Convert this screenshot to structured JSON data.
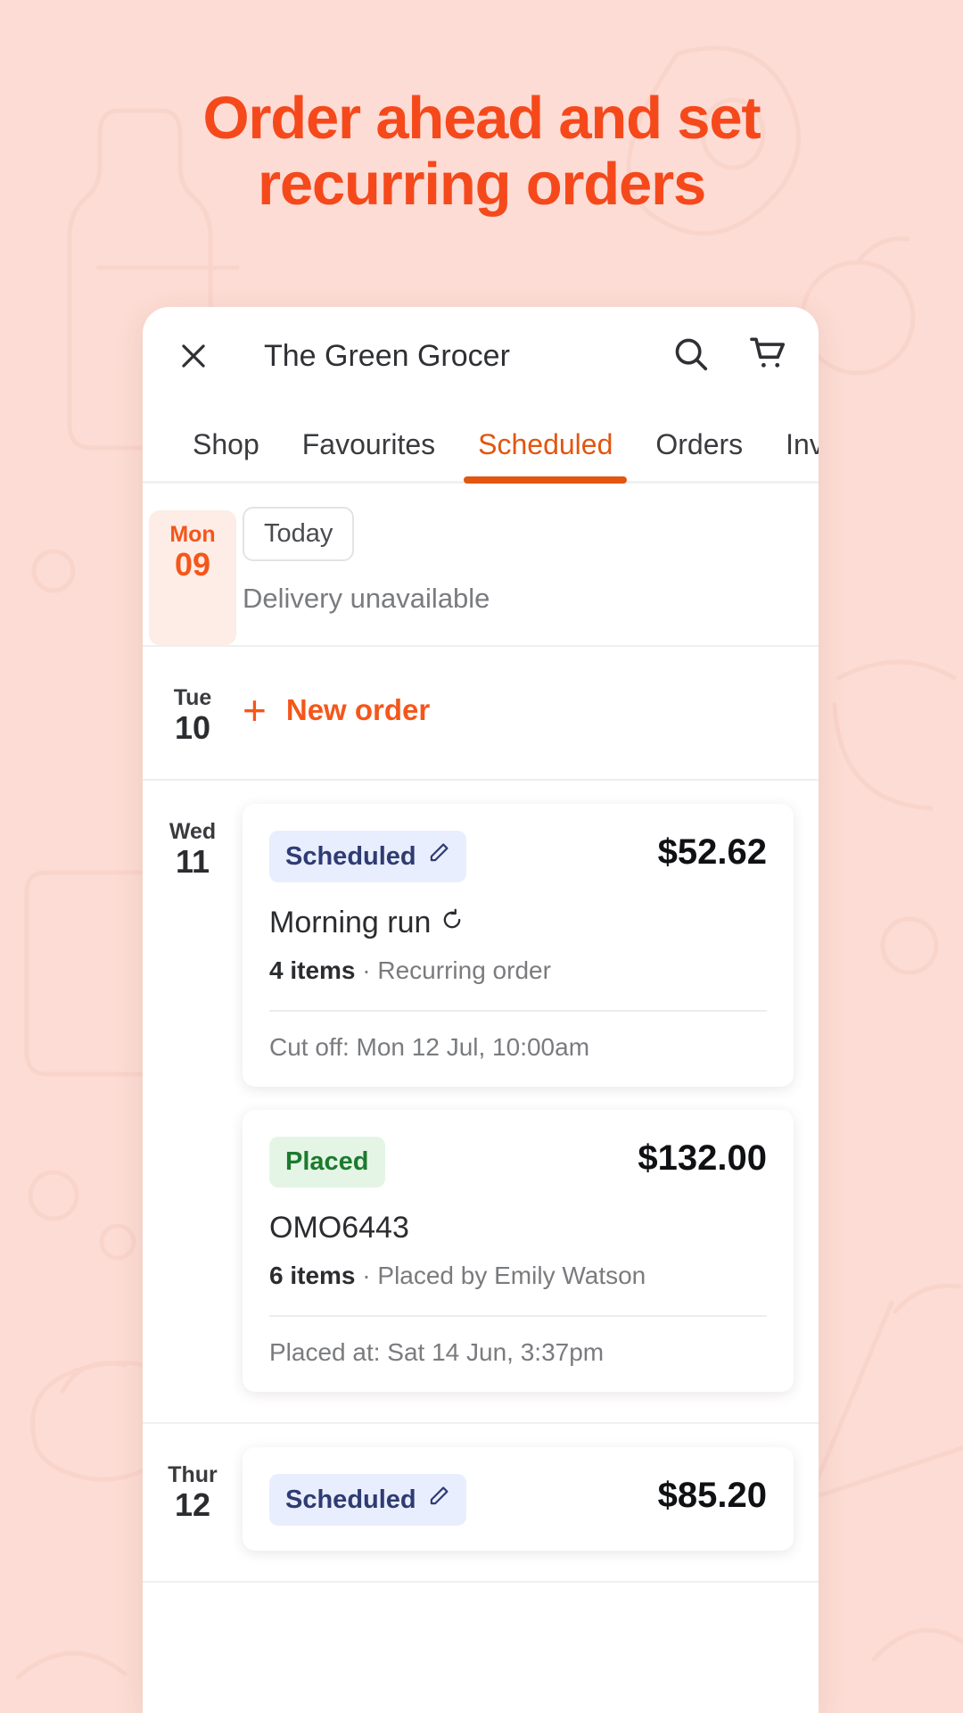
{
  "theme": {
    "background": "#FCDCD4",
    "accent": "#F5491C",
    "tab_active": "#E2560F",
    "badge_scheduled_bg": "#E8EEFD",
    "badge_scheduled_fg": "#2F3B73",
    "badge_placed_bg": "#E4F5E6",
    "badge_placed_fg": "#1C7A2E",
    "today_chip_bg": "#FDEDE6"
  },
  "headline": "Order ahead and set recurring orders",
  "app": {
    "close_icon": "close-icon",
    "title": "The Green Grocer",
    "actions": [
      {
        "icon": "search-icon"
      },
      {
        "icon": "cart-icon"
      }
    ],
    "tabs": [
      {
        "label": "Shop",
        "active": false
      },
      {
        "label": "Favourites",
        "active": false
      },
      {
        "label": "Scheduled",
        "active": true
      },
      {
        "label": "Orders",
        "active": false
      },
      {
        "label": "Inv",
        "active": false
      }
    ]
  },
  "days": [
    {
      "dow": "Mon",
      "num": "09",
      "is_today": true,
      "today_pill": "Today",
      "status": "Delivery unavailable"
    },
    {
      "dow": "Tue",
      "num": "10",
      "is_today": false,
      "new_order_label": "New order",
      "new_order_icon": "plus-icon"
    },
    {
      "dow": "Wed",
      "num": "11",
      "is_today": false,
      "orders": [
        {
          "badge": "Scheduled",
          "badge_type": "scheduled",
          "badge_icon": "pencil-icon",
          "price": "$52.62",
          "name": "Morning run",
          "name_icon": "recurring-icon",
          "items": "4 items",
          "separator": " · ",
          "detail": "Recurring order",
          "footer": "Cut off: Mon 12 Jul, 10:00am"
        },
        {
          "badge": "Placed",
          "badge_type": "placed",
          "badge_icon": "",
          "price": "$132.00",
          "name": "OMO6443",
          "name_icon": "",
          "items": "6 items",
          "separator": " · ",
          "detail": "Placed by Emily Watson",
          "footer": "Placed at: Sat 14 Jun, 3:37pm"
        }
      ]
    },
    {
      "dow": "Thur",
      "num": "12",
      "is_today": false,
      "orders": [
        {
          "badge": "Scheduled",
          "badge_type": "scheduled",
          "badge_icon": "pencil-icon",
          "price": "$85.20",
          "name": "",
          "name_icon": "",
          "items": "",
          "separator": "",
          "detail": "",
          "footer": ""
        }
      ]
    }
  ]
}
